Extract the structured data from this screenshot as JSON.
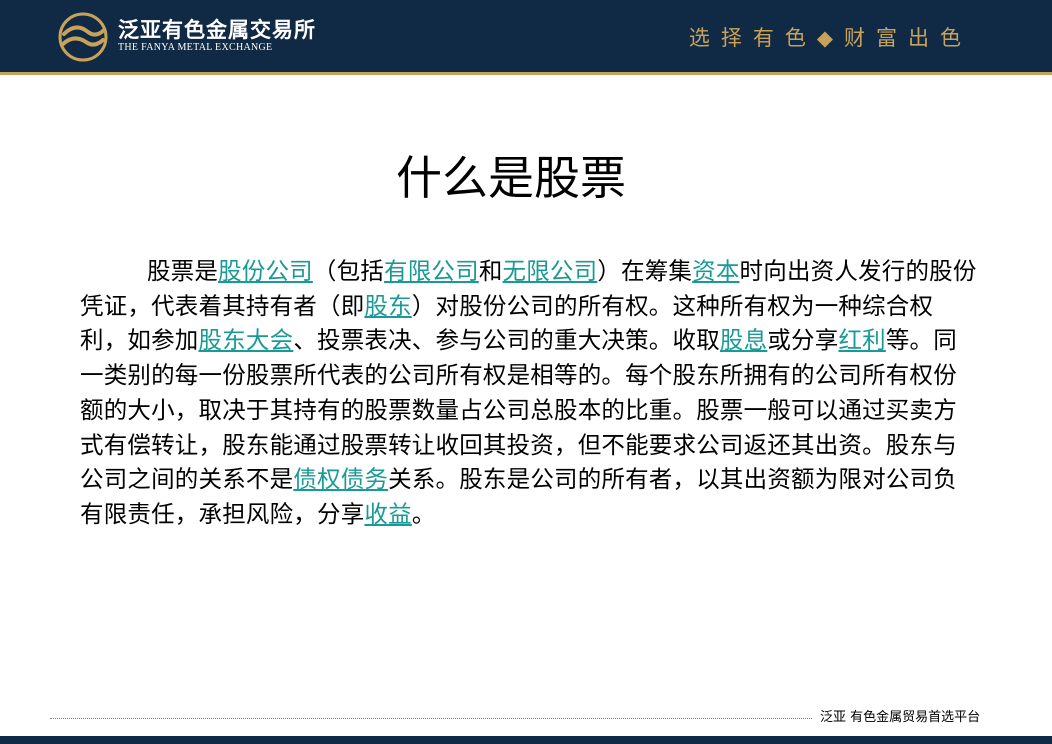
{
  "header": {
    "brand_cn": "泛亚有色金属交易所",
    "brand_en": "THE FANYA METAL EXCHANGE",
    "slogan": "选择有色◆财富出色",
    "logo_icon": "fanya-logo-icon",
    "background_color": "#102a46",
    "accent_color": "#c9a25a"
  },
  "main": {
    "title": "什么是股票",
    "paragraph": [
      {
        "text": "股票是"
      },
      {
        "text": "股份公司",
        "link": true
      },
      {
        "text": "（包括"
      },
      {
        "text": "有限公司",
        "link": true
      },
      {
        "text": "和"
      },
      {
        "text": "无限公司",
        "link": true
      },
      {
        "text": "）在筹集"
      },
      {
        "text": "资本",
        "link": true
      },
      {
        "text": "时向出资人发行的股份凭证，代表着其持有者（即"
      },
      {
        "text": "股东",
        "link": true
      },
      {
        "text": "）对股份公司的所有权。这种所有权为一种综合权利，如参加"
      },
      {
        "text": "股东大会",
        "link": true
      },
      {
        "text": "、投票表决、参与公司的重大决策。收取"
      },
      {
        "text": "股息",
        "link": true
      },
      {
        "text": "或分享"
      },
      {
        "text": "红利",
        "link": true
      },
      {
        "text": "等。同一类别的每一份股票所代表的公司所有权是相等的。每个股东所拥有的公司所有权份额的大小，取决于其持有的股票数量占公司总股本的比重。股票一般可以通过买卖方式有偿转让，股东能通过股票转让收回其投资，但不能要求公司返还其出资。股东与公司之间的关系不是"
      },
      {
        "text": "债权债务",
        "link": true
      },
      {
        "text": "关系。股东是公司的所有者，以其出资额为限对公司负有限责任，承担风险，分享"
      },
      {
        "text": "收益",
        "link": true
      },
      {
        "text": "。"
      }
    ],
    "link_color": "#1a9a96"
  },
  "footer": {
    "text": "泛亚  有色金属贸易首选平台"
  }
}
